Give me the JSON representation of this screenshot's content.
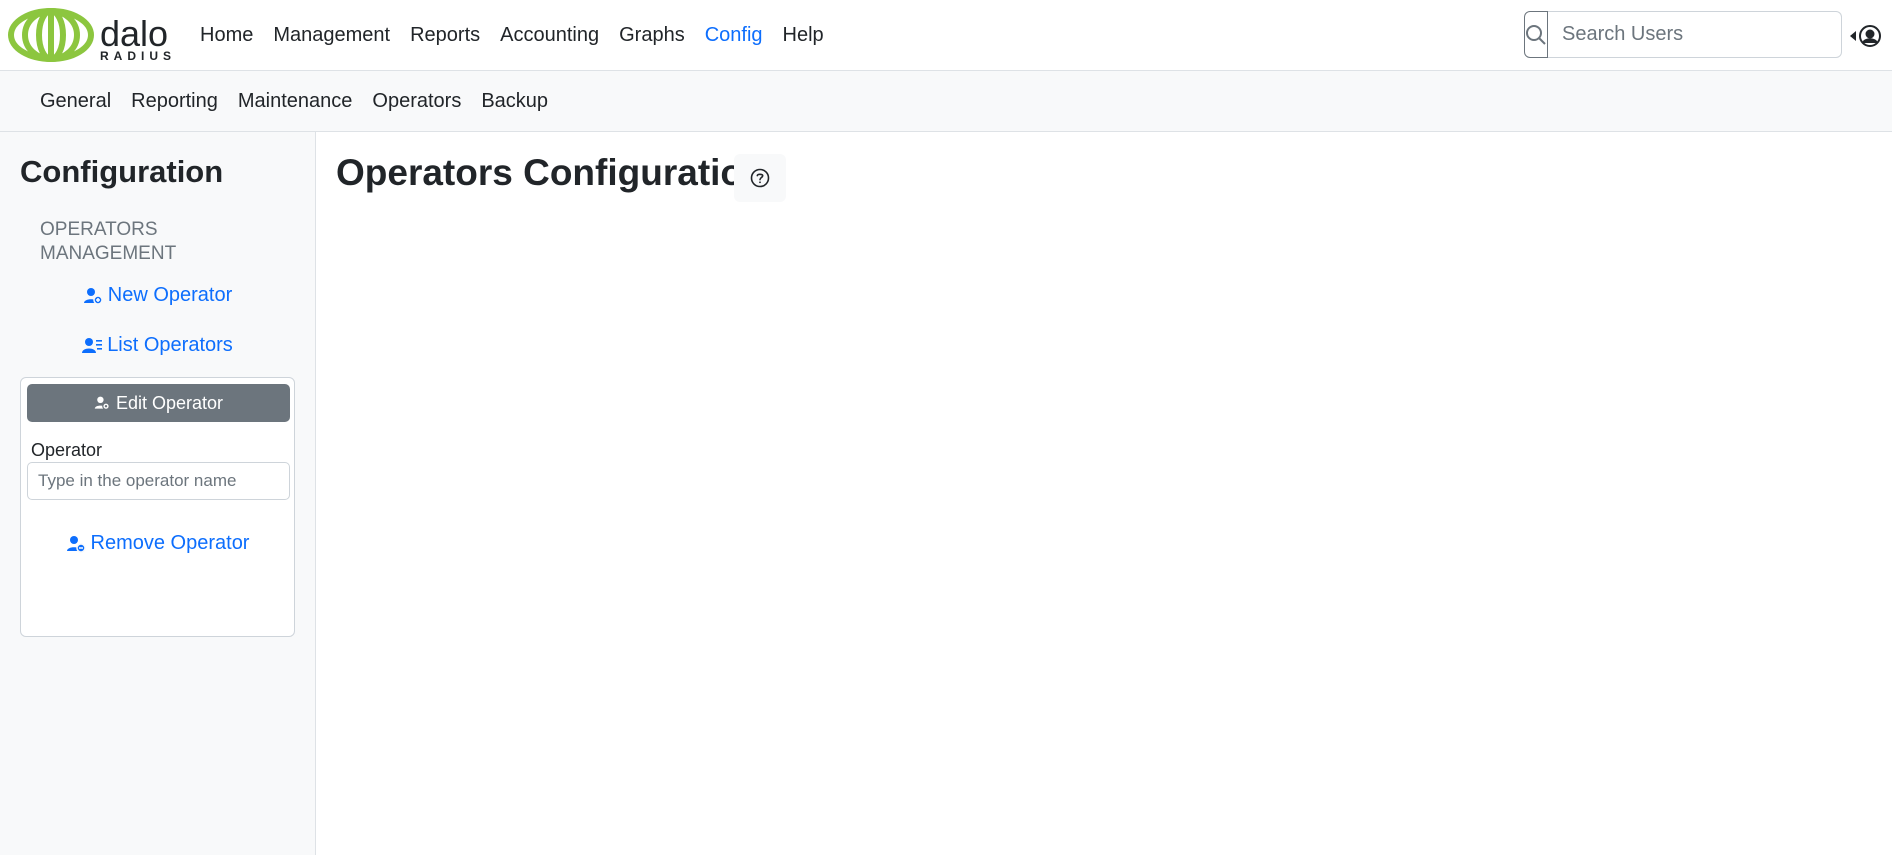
{
  "brand": {
    "logo_text_top": "dalo",
    "logo_text_bottom": "RADIUS",
    "accent": "#0d6efd",
    "logo_green": "#8cc63f"
  },
  "nav": {
    "items": [
      {
        "label": "Home",
        "active": false
      },
      {
        "label": "Management",
        "active": false
      },
      {
        "label": "Reports",
        "active": false
      },
      {
        "label": "Accounting",
        "active": false
      },
      {
        "label": "Graphs",
        "active": false
      },
      {
        "label": "Config",
        "active": true
      },
      {
        "label": "Help",
        "active": false
      }
    ]
  },
  "search": {
    "placeholder": "Search Users",
    "icon": "search-icon"
  },
  "user_menu": {
    "icon": "user-circle-icon"
  },
  "subnav": {
    "items": [
      "General",
      "Reporting",
      "Maintenance",
      "Operators",
      "Backup"
    ]
  },
  "sidebar": {
    "title": "Configuration",
    "heading": "OPERATORS MANAGEMENT",
    "links": {
      "new": "New Operator",
      "list": "List Operators",
      "remove": "Remove Operator"
    },
    "edit": {
      "button": "Edit Operator",
      "label": "Operator",
      "placeholder": "Type in the operator name"
    }
  },
  "main": {
    "title": "Operators Configuration",
    "help_icon": "question-circle-icon"
  }
}
